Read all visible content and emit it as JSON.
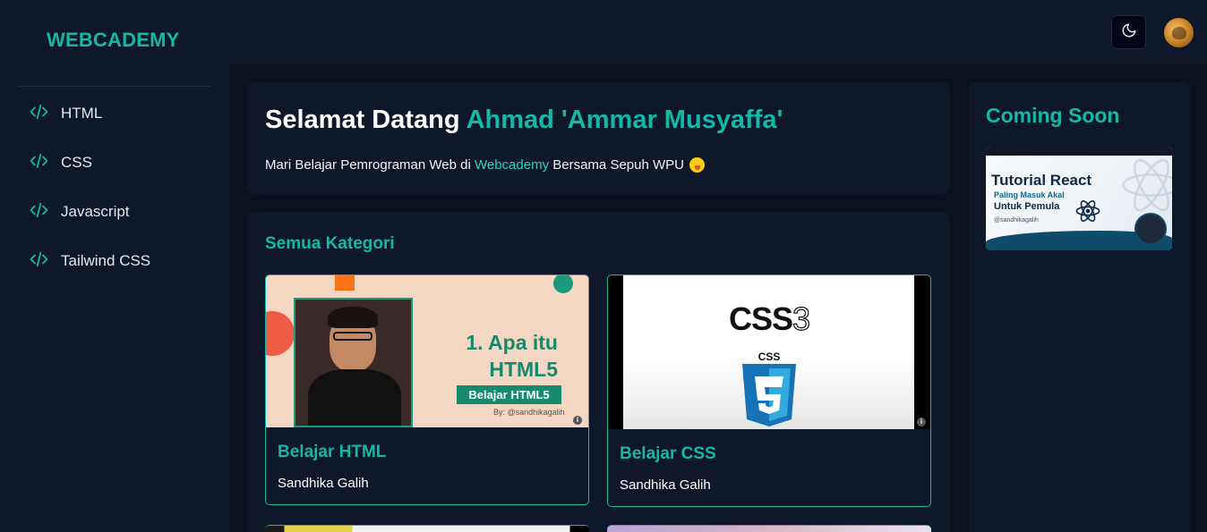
{
  "app": {
    "brand": "WEBCADEMY",
    "accent_color": "#14b8a6",
    "background_color": "#0b1120",
    "panel_color": "#0f172a"
  },
  "header": {
    "theme_toggle_icon": "moon-icon",
    "avatar_icon": "user-avatar"
  },
  "sidebar": {
    "items": [
      {
        "label": "HTML",
        "icon": "code-icon"
      },
      {
        "label": "CSS",
        "icon": "code-icon"
      },
      {
        "label": "Javascript",
        "icon": "code-icon"
      },
      {
        "label": "Tailwind CSS",
        "icon": "code-icon"
      }
    ]
  },
  "welcome": {
    "title_prefix": "Selamat Datang",
    "user_name": "Ahmad 'Ammar Musyaffa'",
    "subtitle_prefix": "Mari Belajar Pemrograman Web di",
    "subtitle_link": "Webcademy",
    "subtitle_suffix": "Bersama Sepuh WPU",
    "emoji_icon": "tongue-face-emoji"
  },
  "categories": {
    "title": "Semua Kategori",
    "courses": [
      {
        "name": "Belajar HTML",
        "author": "Sandhika Galih",
        "thumb": {
          "line1": "1. Apa itu",
          "line2": "HTML5",
          "tag": "Belajar HTML5",
          "by": "By: @sandhikagalih"
        }
      },
      {
        "name": "Belajar CSS",
        "author": "Sandhika Galih",
        "thumb": {
          "text": "CSS",
          "version": "3",
          "shield_text": "CSS"
        }
      }
    ]
  },
  "coming_soon": {
    "title": "Coming Soon",
    "thumb": {
      "title": "Tutorial React",
      "sub1": "Paling Masuk Akal",
      "sub2": "Untuk Pemula",
      "handle": "@sandhikagalih"
    }
  }
}
